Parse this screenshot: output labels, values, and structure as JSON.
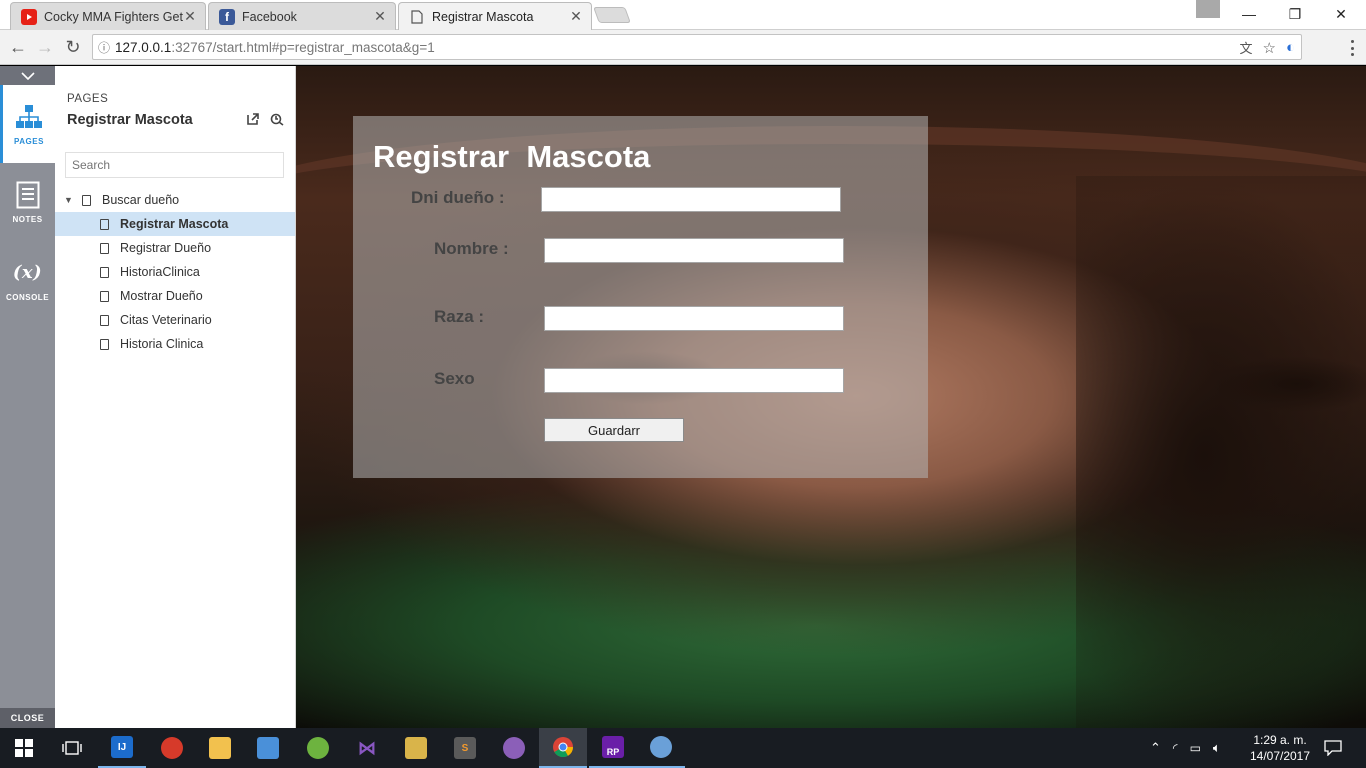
{
  "browser": {
    "tabs": [
      {
        "title": "Cocky MMA Fighters Get",
        "favicon": "youtube-icon",
        "favicon_color": "#e62117"
      },
      {
        "title": "Facebook",
        "favicon": "facebook-icon",
        "favicon_color": "#3b5998"
      },
      {
        "title": "Registrar Mascota",
        "favicon": "page-icon",
        "favicon_color": "#666666"
      }
    ],
    "url_host": "127.0.0.1",
    "url_path": ":32767/start.html#p=registrar_mascota&g=1"
  },
  "rail": {
    "items": [
      {
        "label": "PAGES",
        "icon": "sitemap-icon"
      },
      {
        "label": "NOTES",
        "icon": "notes-icon"
      },
      {
        "label": "CONSOLE",
        "icon": "variable-icon",
        "glyph": "(x)"
      }
    ],
    "close_label": "CLOSE"
  },
  "panel": {
    "header": "PAGES",
    "title": "Registrar Mascota",
    "search_placeholder": "Search",
    "root": "Buscar dueño",
    "pages": [
      "Registrar Mascota",
      "Registrar Dueño",
      "HistoriaClinica",
      "Mostrar Dueño",
      "Citas Veterinario",
      "Historia Clinica"
    ],
    "selected": "Registrar Mascota"
  },
  "form": {
    "title": "Registrar  Mascota",
    "labels": {
      "dni": "Dni dueño :",
      "nombre": "Nombre :",
      "raza": "Raza :",
      "sexo": "Sexo"
    },
    "button": "Guardarr"
  },
  "taskbar": {
    "time": "1:29 a. m.",
    "date": "14/07/2017",
    "apps": [
      {
        "name": "intellij",
        "label": "IJ",
        "color": "#1c6ccc"
      },
      {
        "name": "ccleaner",
        "label": "",
        "color": "#d63a2a"
      },
      {
        "name": "file-explorer",
        "label": "",
        "color": "#f2c14e"
      },
      {
        "name": "virtualbox",
        "label": "",
        "color": "#4a90d9"
      },
      {
        "name": "spring-tool-suite",
        "label": "",
        "color": "#6db33f"
      },
      {
        "name": "visual-studio",
        "label": "",
        "color": "#8957c2"
      },
      {
        "name": "tools",
        "label": "",
        "color": "#d9b44a"
      },
      {
        "name": "sublime-text",
        "label": "S",
        "color": "#5a5a5a"
      },
      {
        "name": "github",
        "label": "",
        "color": "#8b5fb8"
      },
      {
        "name": "chrome",
        "label": "",
        "color": "#4285f4"
      },
      {
        "name": "axure-rp",
        "label": "RP",
        "color": "#6a1fa8"
      },
      {
        "name": "paint",
        "label": "",
        "color": "#6aa0d8"
      }
    ]
  }
}
